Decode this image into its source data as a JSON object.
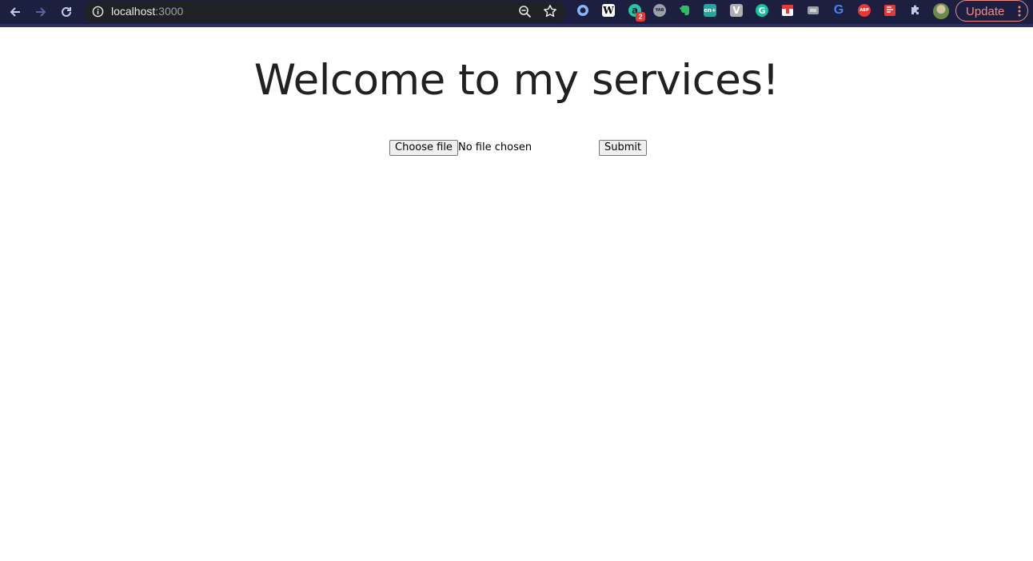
{
  "browser": {
    "url_host": "localhost",
    "url_port": ":3000",
    "icons": {
      "back": "arrow-left-icon",
      "forward": "arrow-right-icon",
      "reload": "reload-icon",
      "site_info": "info-icon",
      "zoom": "zoom-out-icon",
      "bookmark": "star-icon",
      "extensions": "puzzle-icon",
      "menu": "vertical-dots-icon"
    },
    "extensions": [
      {
        "name": "extension-blue-ring",
        "text": "",
        "color": "#8ab4f8"
      },
      {
        "name": "extension-wikipedia",
        "text": "W",
        "color": "#ffffff"
      },
      {
        "name": "extension-green-a",
        "text": "a",
        "color": "#26c6a0"
      },
      {
        "name": "extension-yab",
        "text": "YAB",
        "color": "#9aa0a6"
      },
      {
        "name": "extension-evernote",
        "text": "",
        "color": "#2dbe60"
      },
      {
        "name": "extension-en-plus",
        "text": "en+",
        "color": "#26a69a"
      },
      {
        "name": "extension-v",
        "text": "V",
        "color": "#b0b0b0"
      },
      {
        "name": "extension-grammarly",
        "text": "G",
        "color": "#15c39a"
      },
      {
        "name": "extension-red-white",
        "text": "",
        "color": "#e53935"
      },
      {
        "name": "extension-gray",
        "text": "",
        "color": "#9aa0a6"
      },
      {
        "name": "extension-google",
        "text": "G",
        "color": "#4285f4"
      },
      {
        "name": "extension-abp",
        "text": "ABP",
        "color": "#e53935"
      },
      {
        "name": "extension-red-square",
        "text": "",
        "color": "#e53935"
      }
    ],
    "badge_count": "2",
    "update_label": "Update",
    "update_color": "#f28b82",
    "toolbar_color": "#1c1f3f"
  },
  "page": {
    "title": "Welcome to my services!",
    "choose_file_label": "Choose file",
    "file_status": "No file chosen",
    "submit_label": "Submit"
  }
}
